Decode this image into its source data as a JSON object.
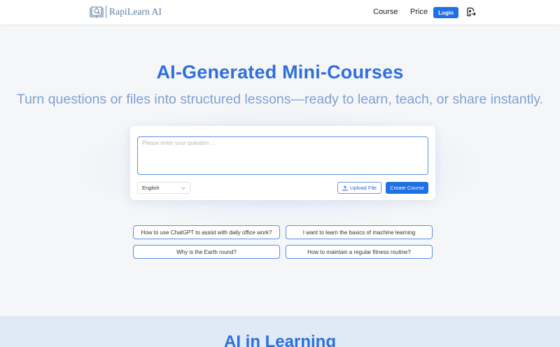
{
  "brand": {
    "name": "RapiLearn AI",
    "accent": "#1f6fe5",
    "logo_icon": "book-magnifier-icon"
  },
  "nav": {
    "course": "Course",
    "price": "Price",
    "login": "Login",
    "export_icon": "export-icon"
  },
  "hero": {
    "title": "AI-Generated Mini-Courses",
    "subtitle": "Turn questions or files into structured lessons—ready to learn, teach, or share instantly."
  },
  "composer": {
    "placeholder": "Please enter your question ...",
    "language": "English",
    "upload_label": "Upload File",
    "create_label": "Create Course"
  },
  "suggestions": [
    "How to use ChatGPT to assist with daily office work?",
    "I want to learn the basics of machine learning",
    "Why is the Earth round?",
    "How to maintain a regular fitness routine?"
  ],
  "next_section": {
    "title": "AI in Learning"
  }
}
